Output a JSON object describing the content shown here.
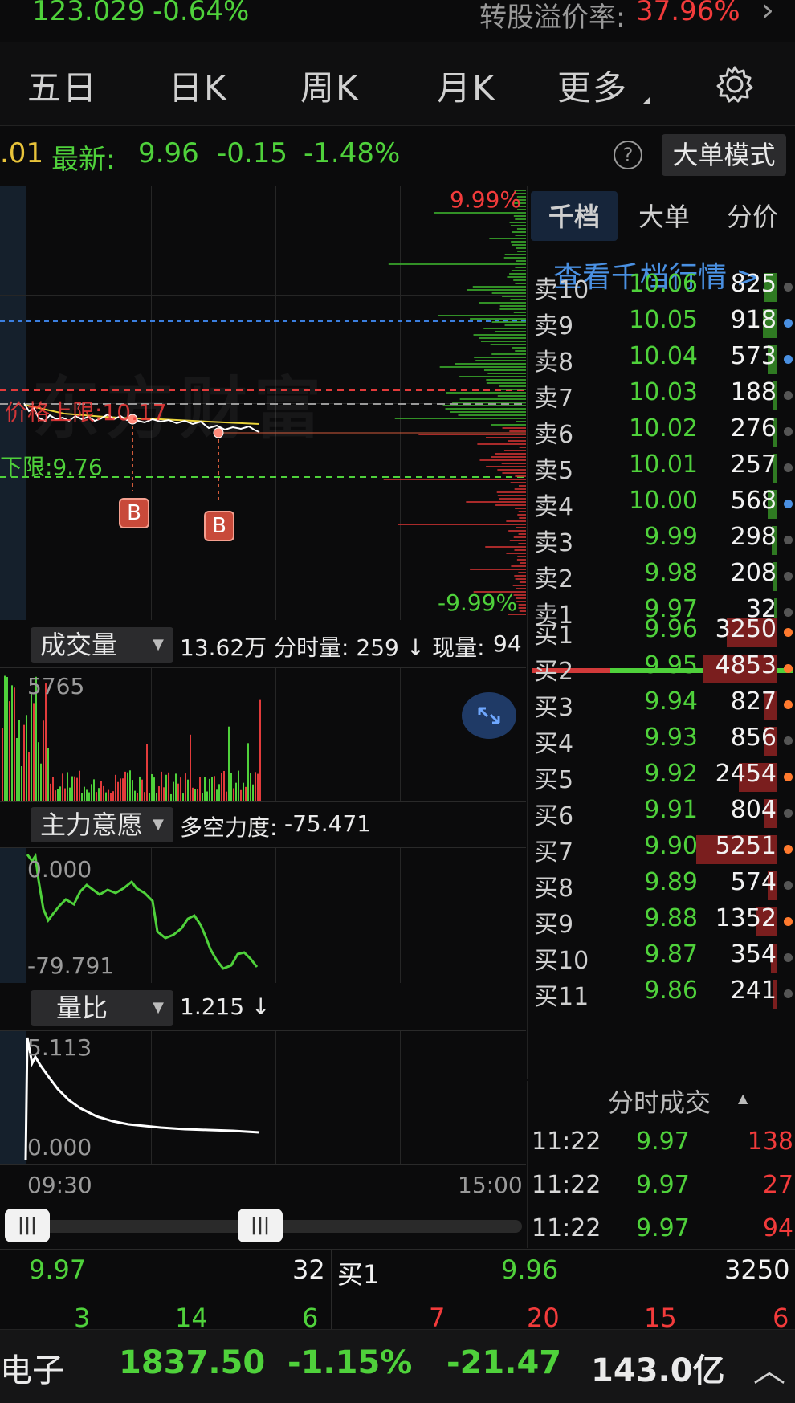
{
  "top_strip": {
    "price": "123.029",
    "change_pct": "-0.64%",
    "premium_label": "转股溢价率:",
    "premium_value": "37.96%",
    "chevron": "›"
  },
  "tabs": [
    "五日",
    "日K",
    "周K",
    "月K",
    "更多"
  ],
  "info": {
    "prefix": ".01",
    "latest_label": "最新:",
    "latest": "9.96",
    "change": "-0.15",
    "change_pct": "-1.48%",
    "help": "?",
    "mode_button": "大单模式"
  },
  "chart": {
    "upper_pct": "9.99%",
    "lower_pct": "-9.99%",
    "upper_limit_label": "价格上限:10.17",
    "lower_limit_label": "下限:9.76",
    "markers": [
      "B",
      "B"
    ],
    "watermark": "东方财富"
  },
  "volume": {
    "selector": "成交量",
    "summary": "13.62万 分时量: 259 ↓ 现量:",
    "current": "94",
    "max_label": "5765"
  },
  "mainforce": {
    "selector": "主力意愿",
    "summary_label": "多空力度:",
    "summary_value": "-75.471",
    "top_label": "0.000",
    "bottom_label": "-79.791"
  },
  "ratio": {
    "selector": "量比",
    "summary": "1.215 ↓",
    "top_label": "5.113",
    "bottom_label": "0.000"
  },
  "time_axis": {
    "start": "09:30",
    "end": "15:00"
  },
  "orderbook": {
    "tabs": [
      "千档",
      "大单",
      "分价"
    ],
    "link": "查看千档行情 >",
    "asks": [
      {
        "label": "卖10",
        "price": "10.06",
        "vol": "825",
        "dot": "#555555"
      },
      {
        "label": "卖9",
        "price": "10.05",
        "vol": "918",
        "dot": "#4a90e2"
      },
      {
        "label": "卖8",
        "price": "10.04",
        "vol": "573",
        "dot": "#4a90e2"
      },
      {
        "label": "卖7",
        "price": "10.03",
        "vol": "188",
        "dot": "#555555"
      },
      {
        "label": "卖6",
        "price": "10.02",
        "vol": "276",
        "dot": "#555555"
      },
      {
        "label": "卖5",
        "price": "10.01",
        "vol": "257",
        "dot": "#555555"
      },
      {
        "label": "卖4",
        "price": "10.00",
        "vol": "568",
        "dot": "#4a90e2"
      },
      {
        "label": "卖3",
        "price": "9.99",
        "vol": "298",
        "dot": "#555555"
      },
      {
        "label": "卖2",
        "price": "9.98",
        "vol": "208",
        "dot": "#555555"
      },
      {
        "label": "卖1",
        "price": "9.97",
        "vol": "32",
        "dot": "#555555"
      }
    ],
    "bids": [
      {
        "label": "买1",
        "price": "9.96",
        "vol": "3250",
        "dot": "#ff7a2e"
      },
      {
        "label": "买2",
        "price": "9.95",
        "vol": "4853",
        "dot": "#ff7a2e"
      },
      {
        "label": "买3",
        "price": "9.94",
        "vol": "827",
        "dot": "#ff7a2e"
      },
      {
        "label": "买4",
        "price": "9.93",
        "vol": "856",
        "dot": "#555555"
      },
      {
        "label": "买5",
        "price": "9.92",
        "vol": "2454",
        "dot": "#ff7a2e"
      },
      {
        "label": "买6",
        "price": "9.91",
        "vol": "804",
        "dot": "#555555"
      },
      {
        "label": "买7",
        "price": "9.90",
        "vol": "5251",
        "dot": "#ff7a2e"
      },
      {
        "label": "买8",
        "price": "9.89",
        "vol": "574",
        "dot": "#555555"
      },
      {
        "label": "买9",
        "price": "9.88",
        "vol": "1352",
        "dot": "#ff7a2e"
      },
      {
        "label": "买10",
        "price": "9.87",
        "vol": "354",
        "dot": "#555555"
      },
      {
        "label": "买11",
        "price": "9.86",
        "vol": "241",
        "dot": "#555555"
      }
    ],
    "trades_title": "分时成交",
    "trades": [
      {
        "time": "11:22",
        "price": "9.97",
        "vol": "138"
      },
      {
        "time": "11:22",
        "price": "9.97",
        "vol": "27"
      },
      {
        "time": "11:22",
        "price": "9.97",
        "vol": "94"
      }
    ]
  },
  "bottom_quote": {
    "ask_price": "9.97",
    "ask_vol": "32",
    "bid_label": "买1",
    "bid_price": "9.96",
    "bid_vol": "3250",
    "counts_left": [
      "3",
      "14",
      "6"
    ],
    "counts_right": [
      "7",
      "20",
      "15",
      "6"
    ]
  },
  "sector": {
    "name": "电子",
    "index": "1837.50",
    "change_pct": "-1.15%",
    "change": "-21.47",
    "amount": "143.0亿",
    "chevron": "︿"
  },
  "colors": {
    "green": "#4fd13b",
    "red": "#f23b3b",
    "blue": "#4a90e2",
    "bg": "#0b0b0c"
  }
}
